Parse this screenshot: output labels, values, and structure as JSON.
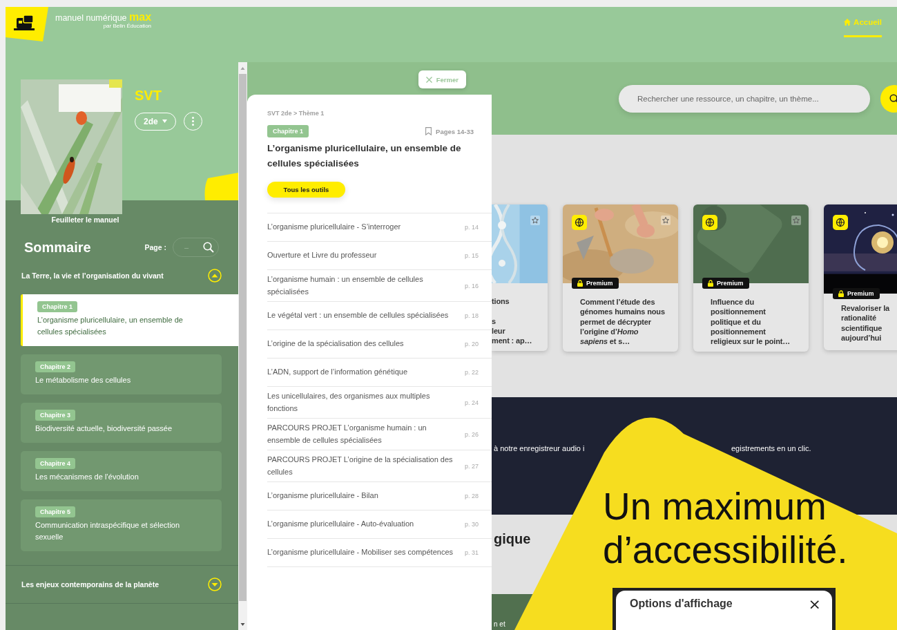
{
  "header": {
    "logo_text": "manuel numérique **max**",
    "publisher": "par Belin Éducation",
    "nav": [
      {
        "label": "Accueil",
        "selected": true
      }
    ]
  },
  "book": {
    "subject": "SVT",
    "level": "2de",
    "browse_link": "Feuilleter le manuel"
  },
  "summary": {
    "title": "Sommaire",
    "page_label": "Page :",
    "page_placeholder": "–",
    "sections": [
      {
        "title": "La Terre, la vie et l’organisation du vivant",
        "expanded": true,
        "chapters": [
          {
            "tag": "Chapitre 1",
            "title": "L’organisme pluricellulaire, un ensemble de cellules spécialisées",
            "selected": true
          },
          {
            "tag": "Chapitre 2",
            "title": "Le métabolisme des cellules",
            "selected": false
          },
          {
            "tag": "Chapitre 3",
            "title": "Biodiversité actuelle, biodiversité passée",
            "selected": false
          },
          {
            "tag": "Chapitre 4",
            "title": "Les mécanismes de l’évolution",
            "selected": false
          },
          {
            "tag": "Chapitre 5",
            "title": "Communication intraspécifique et sélection sexuelle",
            "selected": false
          }
        ]
      },
      {
        "title": "Les enjeux contemporains de la planète",
        "expanded": false
      }
    ]
  },
  "chapter_panel": {
    "close": "Fermer",
    "breadcrumb": "SVT 2de > Thème 1",
    "tag": "Chapitre 1",
    "pages": "Pages 14-33",
    "title": "L’organisme pluricellulaire, un ensemble de cellules spécialisées",
    "tools_button": "Tous les outils",
    "items": [
      {
        "title": "L’organisme pluricellulaire - S’interroger",
        "page": "p. 14"
      },
      {
        "title": "Ouverture et Livre du professeur",
        "page": "p. 15"
      },
      {
        "title": "L’organisme humain : un ensemble de cellules spécialisées",
        "page": "p. 16"
      },
      {
        "title": "Le végétal vert : un ensemble de cellules spécialisées",
        "page": "p. 18"
      },
      {
        "title": "L’origine de la spécialisation des cellules",
        "page": "p. 20"
      },
      {
        "title": "L’ADN, support de l’information génétique",
        "page": "p. 22"
      },
      {
        "title": "Les unicellulaires, des organismes aux multiples fonctions",
        "page": "p. 24"
      },
      {
        "title": "PARCOURS PROJET L’organisme humain : un ensemble de cellules spécialisées",
        "page": "p. 26"
      },
      {
        "title": "PARCOURS PROJET L’origine de la spécialisation des cellules",
        "page": "p. 27"
      },
      {
        "title": "L’organisme pluricellulaire - Bilan",
        "page": "p. 28"
      },
      {
        "title": "L’organisme pluricellulaire - Auto-évaluation",
        "page": "p. 30"
      },
      {
        "title": "L’organisme pluricellulaire - Mobiliser ses compétences",
        "page": "p. 31"
      }
    ]
  },
  "search": {
    "placeholder": "Rechercher une ressource, un chapitre, un thème..."
  },
  "cards": [
    {
      "kind": "cut_left",
      "title": "tions\n\ns\nleur\nment : ap…",
      "premium": false
    },
    {
      "kind": "full",
      "title": "Comment l’étude des génomes humains nous permet de décrypter l’origine d’*Homo sapiens* et s…",
      "premium": true,
      "badge": "Premium"
    },
    {
      "kind": "full",
      "title": "Influence du positionnement politique et du positionnement religieux sur le point…",
      "premium": true,
      "badge": "Premium"
    },
    {
      "kind": "cut_right",
      "title": "Revaloriser la rationalité scientifique aujourd’hui",
      "premium": true,
      "badge": "Premium"
    }
  ],
  "banner": {
    "fragments": [
      "à notre enregistreur audio i",
      "egistrements en un clic."
    ]
  },
  "section_heading": "gique",
  "footer_fragment": "n et",
  "promo": {
    "headline": "Un maximum d’accessibilité.",
    "dialog": {
      "title": "Options d'affichage",
      "close": "×"
    }
  }
}
